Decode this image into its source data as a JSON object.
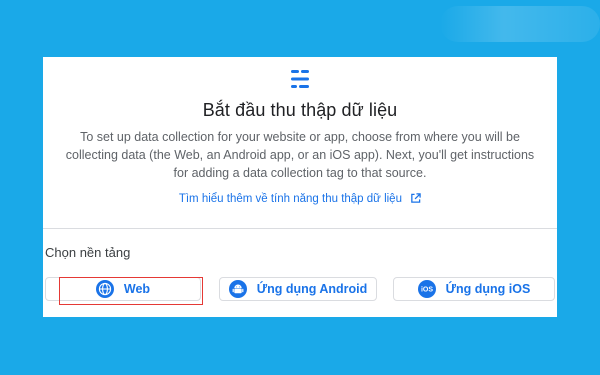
{
  "dialog": {
    "logo_icon": "data-streams-icon",
    "title": "Bắt đầu thu thập dữ liệu",
    "description": "To set up data collection for your website or app, choose from where you will be collecting data (the Web, an Android app, or an iOS app). Next, you'll get instructions for adding a data collection tag to that source.",
    "learn_more_link": "Tìm hiểu thêm về tính năng thu thập dữ liệu",
    "learn_more_icon": "open-in-new-icon"
  },
  "platform": {
    "label": "Chọn nền tảng",
    "buttons": [
      {
        "label": "Web",
        "icon": "globe-icon"
      },
      {
        "label": "Ứng dụng Android",
        "icon": "android-icon"
      },
      {
        "label": "Ứng dụng iOS",
        "icon": "ios-icon",
        "icon_text": "iOS"
      }
    ],
    "highlighted": "Web"
  },
  "colors": {
    "background": "#1aa9e8",
    "accent": "#1a73e8",
    "highlight": "#e53935"
  }
}
